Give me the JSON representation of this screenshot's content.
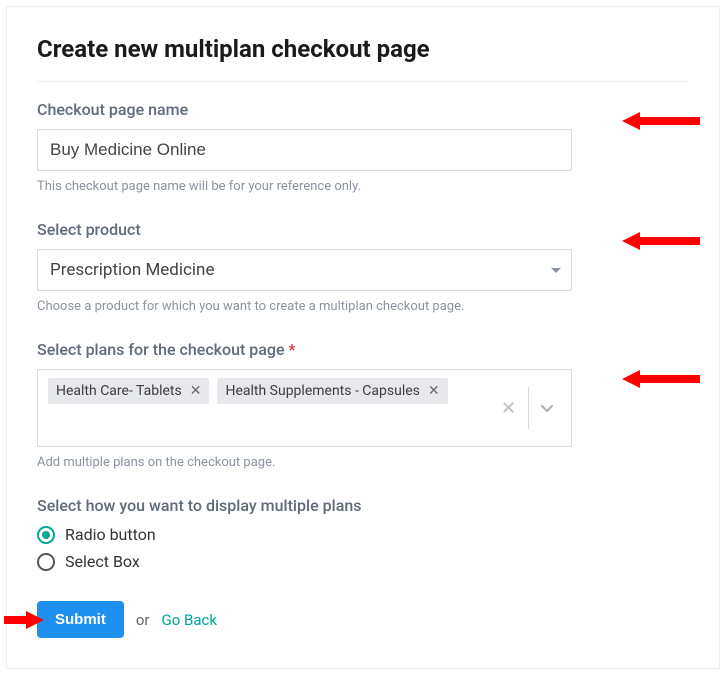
{
  "page": {
    "title": "Create new multiplan checkout page"
  },
  "fields": {
    "name": {
      "label": "Checkout page name",
      "value": "Buy Medicine Online",
      "help": "This checkout page name will be for your reference only."
    },
    "product": {
      "label": "Select product",
      "selected": "Prescription Medicine",
      "help": "Choose a product for which you want to create a multiplan checkout page."
    },
    "plans": {
      "label": "Select plans for the checkout page",
      "required_marker": "*",
      "tags": [
        "Health Care- Tablets",
        "Health Supplements - Capsules"
      ],
      "help": "Add multiple plans on the checkout page."
    },
    "display": {
      "label": "Select how you want to display multiple plans",
      "options": [
        "Radio button",
        "Select Box"
      ],
      "selected": "Radio button"
    }
  },
  "actions": {
    "submit": "Submit",
    "or": "or",
    "go_back": "Go Back"
  }
}
